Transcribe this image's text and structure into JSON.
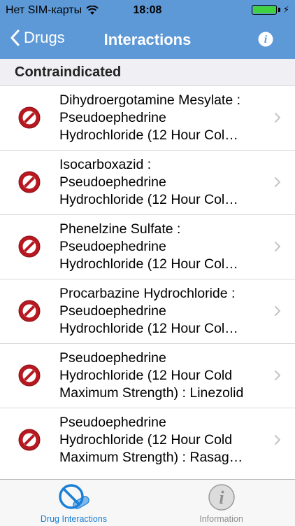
{
  "status_bar": {
    "carrier": "Нет SIM-карты",
    "time": "18:08"
  },
  "nav": {
    "back_label": "Drugs",
    "title": "Interactions"
  },
  "section": {
    "title": "Contraindicated"
  },
  "interactions": [
    {
      "text": "Dihydroergotamine Mesylate :\nPseudoephedrine\nHydrochloride (12 Hour Col…"
    },
    {
      "text": "Isocarboxazid :\nPseudoephedrine\nHydrochloride (12 Hour Col…"
    },
    {
      "text": "Phenelzine Sulfate :\nPseudoephedrine\nHydrochloride (12 Hour Col…"
    },
    {
      "text": "Procarbazine Hydrochloride :\nPseudoephedrine\nHydrochloride (12 Hour Col…"
    },
    {
      "text": "Pseudoephedrine\nHydrochloride (12 Hour Cold\nMaximum Strength) : Linezolid"
    },
    {
      "text": "Pseudoephedrine\nHydrochloride (12 Hour Cold\nMaximum Strength) : Rasag…"
    }
  ],
  "tab_bar": {
    "tabs": [
      {
        "label": "Drug Interactions",
        "selected": true
      },
      {
        "label": "Information",
        "selected": false
      }
    ]
  },
  "colors": {
    "bar_blue": "#5d99d7",
    "tab_active": "#1a7fd6",
    "contraindicated_red": "#b8181f"
  },
  "icons": {
    "row_icon": "no-entry-icon",
    "row_accessory": "chevron-right-icon",
    "nav_right": "info-icon"
  }
}
